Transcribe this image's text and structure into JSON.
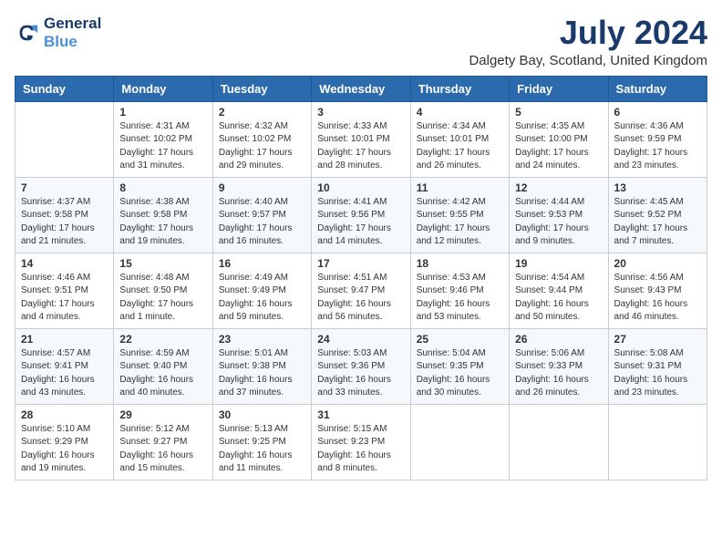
{
  "logo": {
    "line1": "General",
    "line2": "Blue"
  },
  "title": "July 2024",
  "location": "Dalgety Bay, Scotland, United Kingdom",
  "headers": [
    "Sunday",
    "Monday",
    "Tuesday",
    "Wednesday",
    "Thursday",
    "Friday",
    "Saturday"
  ],
  "weeks": [
    [
      {
        "day": "",
        "content": ""
      },
      {
        "day": "1",
        "content": "Sunrise: 4:31 AM\nSunset: 10:02 PM\nDaylight: 17 hours\nand 31 minutes."
      },
      {
        "day": "2",
        "content": "Sunrise: 4:32 AM\nSunset: 10:02 PM\nDaylight: 17 hours\nand 29 minutes."
      },
      {
        "day": "3",
        "content": "Sunrise: 4:33 AM\nSunset: 10:01 PM\nDaylight: 17 hours\nand 28 minutes."
      },
      {
        "day": "4",
        "content": "Sunrise: 4:34 AM\nSunset: 10:01 PM\nDaylight: 17 hours\nand 26 minutes."
      },
      {
        "day": "5",
        "content": "Sunrise: 4:35 AM\nSunset: 10:00 PM\nDaylight: 17 hours\nand 24 minutes."
      },
      {
        "day": "6",
        "content": "Sunrise: 4:36 AM\nSunset: 9:59 PM\nDaylight: 17 hours\nand 23 minutes."
      }
    ],
    [
      {
        "day": "7",
        "content": "Sunrise: 4:37 AM\nSunset: 9:58 PM\nDaylight: 17 hours\nand 21 minutes."
      },
      {
        "day": "8",
        "content": "Sunrise: 4:38 AM\nSunset: 9:58 PM\nDaylight: 17 hours\nand 19 minutes."
      },
      {
        "day": "9",
        "content": "Sunrise: 4:40 AM\nSunset: 9:57 PM\nDaylight: 17 hours\nand 16 minutes."
      },
      {
        "day": "10",
        "content": "Sunrise: 4:41 AM\nSunset: 9:56 PM\nDaylight: 17 hours\nand 14 minutes."
      },
      {
        "day": "11",
        "content": "Sunrise: 4:42 AM\nSunset: 9:55 PM\nDaylight: 17 hours\nand 12 minutes."
      },
      {
        "day": "12",
        "content": "Sunrise: 4:44 AM\nSunset: 9:53 PM\nDaylight: 17 hours\nand 9 minutes."
      },
      {
        "day": "13",
        "content": "Sunrise: 4:45 AM\nSunset: 9:52 PM\nDaylight: 17 hours\nand 7 minutes."
      }
    ],
    [
      {
        "day": "14",
        "content": "Sunrise: 4:46 AM\nSunset: 9:51 PM\nDaylight: 17 hours\nand 4 minutes."
      },
      {
        "day": "15",
        "content": "Sunrise: 4:48 AM\nSunset: 9:50 PM\nDaylight: 17 hours\nand 1 minute."
      },
      {
        "day": "16",
        "content": "Sunrise: 4:49 AM\nSunset: 9:49 PM\nDaylight: 16 hours\nand 59 minutes."
      },
      {
        "day": "17",
        "content": "Sunrise: 4:51 AM\nSunset: 9:47 PM\nDaylight: 16 hours\nand 56 minutes."
      },
      {
        "day": "18",
        "content": "Sunrise: 4:53 AM\nSunset: 9:46 PM\nDaylight: 16 hours\nand 53 minutes."
      },
      {
        "day": "19",
        "content": "Sunrise: 4:54 AM\nSunset: 9:44 PM\nDaylight: 16 hours\nand 50 minutes."
      },
      {
        "day": "20",
        "content": "Sunrise: 4:56 AM\nSunset: 9:43 PM\nDaylight: 16 hours\nand 46 minutes."
      }
    ],
    [
      {
        "day": "21",
        "content": "Sunrise: 4:57 AM\nSunset: 9:41 PM\nDaylight: 16 hours\nand 43 minutes."
      },
      {
        "day": "22",
        "content": "Sunrise: 4:59 AM\nSunset: 9:40 PM\nDaylight: 16 hours\nand 40 minutes."
      },
      {
        "day": "23",
        "content": "Sunrise: 5:01 AM\nSunset: 9:38 PM\nDaylight: 16 hours\nand 37 minutes."
      },
      {
        "day": "24",
        "content": "Sunrise: 5:03 AM\nSunset: 9:36 PM\nDaylight: 16 hours\nand 33 minutes."
      },
      {
        "day": "25",
        "content": "Sunrise: 5:04 AM\nSunset: 9:35 PM\nDaylight: 16 hours\nand 30 minutes."
      },
      {
        "day": "26",
        "content": "Sunrise: 5:06 AM\nSunset: 9:33 PM\nDaylight: 16 hours\nand 26 minutes."
      },
      {
        "day": "27",
        "content": "Sunrise: 5:08 AM\nSunset: 9:31 PM\nDaylight: 16 hours\nand 23 minutes."
      }
    ],
    [
      {
        "day": "28",
        "content": "Sunrise: 5:10 AM\nSunset: 9:29 PM\nDaylight: 16 hours\nand 19 minutes."
      },
      {
        "day": "29",
        "content": "Sunrise: 5:12 AM\nSunset: 9:27 PM\nDaylight: 16 hours\nand 15 minutes."
      },
      {
        "day": "30",
        "content": "Sunrise: 5:13 AM\nSunset: 9:25 PM\nDaylight: 16 hours\nand 11 minutes."
      },
      {
        "day": "31",
        "content": "Sunrise: 5:15 AM\nSunset: 9:23 PM\nDaylight: 16 hours\nand 8 minutes."
      },
      {
        "day": "",
        "content": ""
      },
      {
        "day": "",
        "content": ""
      },
      {
        "day": "",
        "content": ""
      }
    ]
  ]
}
